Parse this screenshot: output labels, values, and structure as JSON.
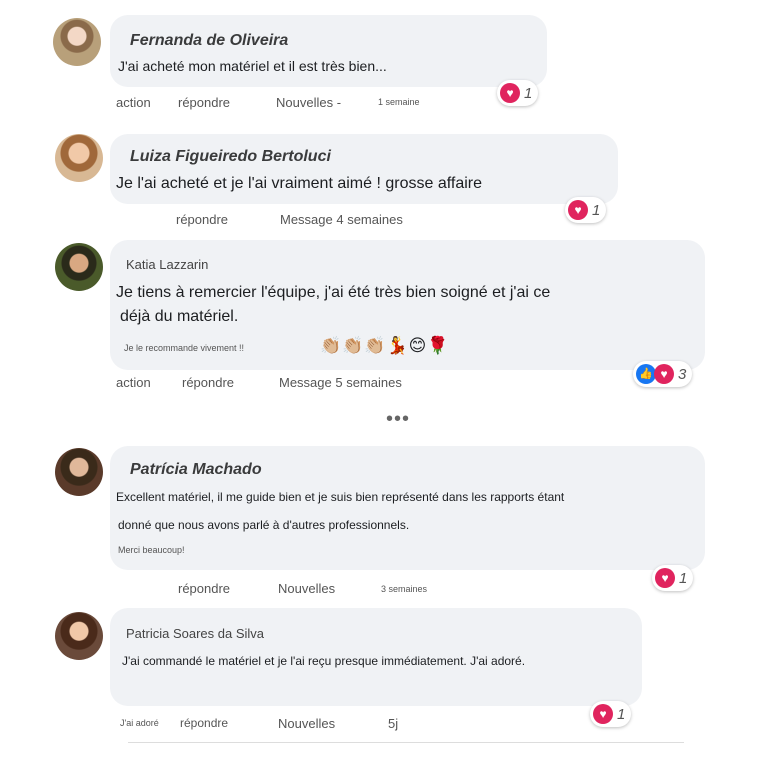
{
  "comments": [
    {
      "name": "Fernanda de Oliveira",
      "text": "J'ai acheté mon matériel et il est très bien...",
      "actions": [
        "action",
        "répondre",
        "Nouvelles -"
      ],
      "time": "1 semaine",
      "reaction_count": "1",
      "avatar_color": "#b8a07a"
    },
    {
      "name": "Luiza Figueiredo Bertoluci",
      "text": "Je l'ai acheté et je l'ai vraiment aimé ! grosse affaire",
      "actions": [
        "répondre",
        "Message 4 semaines"
      ],
      "tiny_label": "",
      "reaction_count": "1",
      "avatar_color": "#c89a6e"
    },
    {
      "name": "Katia Lazzarin",
      "text_line1": "Je tiens à remercier l'équipe, j'ai été très bien soigné et j'ai ce",
      "text_line2": "déjà du matériel.",
      "text_line3": "Je le recommande vivement !!",
      "emoji": "👏🏼👏🏼👏🏼💃😊🌹",
      "actions": [
        "action",
        "répondre",
        "Message 5 semaines"
      ],
      "reaction_count": "3",
      "avatar_color": "#4a5a2a"
    },
    {
      "name": "Patrícia Machado",
      "text_line1": "Excellent matériel, il me guide bien et je suis bien représenté dans les rapports étant",
      "text_line2": "donné que nous avons parlé à d'autres professionnels.",
      "text_line3": "Merci beaucoup!",
      "actions": [
        "répondre",
        "Nouvelles"
      ],
      "time": "3 semaines",
      "reaction_count": "1",
      "avatar_color": "#5a3a2a"
    },
    {
      "name": "Patricia Soares da Silva",
      "text": "J'ai commandé le matériel et je l'ai reçu presque immédiatement. J'ai adoré.",
      "tiny_label": "J'ai adoré",
      "actions": [
        "répondre",
        "Nouvelles"
      ],
      "time": "5j",
      "reaction_count": "1",
      "avatar_color": "#6a4a3a"
    }
  ],
  "more": "•••",
  "colors": {
    "bubble": "#f0f2f5",
    "heart": "#e0245e",
    "like": "#1877f2"
  }
}
